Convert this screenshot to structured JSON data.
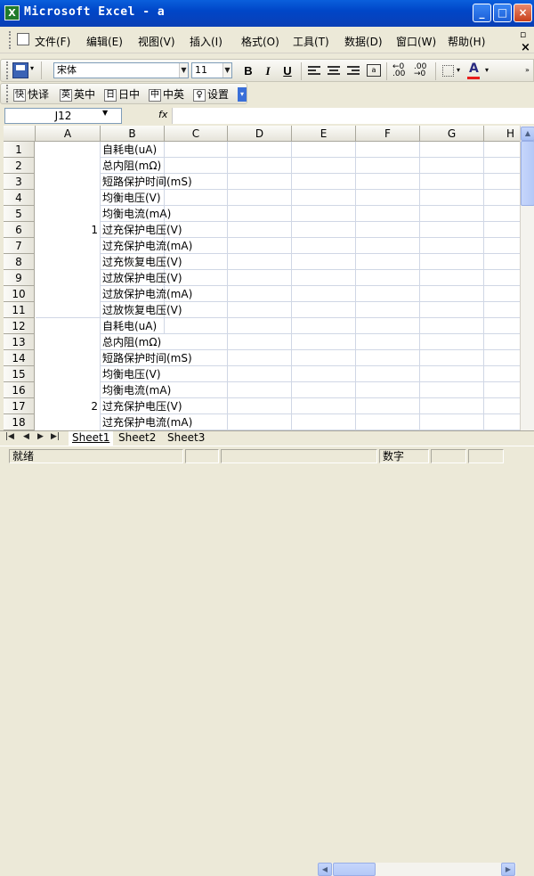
{
  "window": {
    "title": "Microsoft Excel - a",
    "app_icon": "X",
    "minimize": "_",
    "maximize": "□",
    "close": "×"
  },
  "menu": {
    "items": [
      "文件(F)",
      "编辑(E)",
      "视图(V)",
      "插入(I)",
      "格式(O)",
      "工具(T)",
      "数据(D)",
      "窗口(W)",
      "帮助(H)"
    ],
    "doc_restore": "▫",
    "doc_close": "×"
  },
  "toolbar": {
    "font_name": "宋体",
    "font_size": "11",
    "bold": "B",
    "italic": "I",
    "underline": "U"
  },
  "toolbar2": {
    "items": [
      {
        "icon": "快",
        "label": "快译"
      },
      {
        "icon": "英",
        "label": "英中"
      },
      {
        "icon": "日",
        "label": "日中"
      },
      {
        "icon": "中",
        "label": "中英"
      },
      {
        "icon": "♀",
        "label": "设置"
      }
    ]
  },
  "formula_bar": {
    "name_box": "J12",
    "fx": "fx",
    "value": ""
  },
  "grid": {
    "columns": [
      "A",
      "B",
      "C",
      "D",
      "E",
      "F",
      "G",
      "H"
    ],
    "rows": [
      "1",
      "2",
      "3",
      "4",
      "5",
      "6",
      "7",
      "8",
      "9",
      "10",
      "11",
      "12",
      "13",
      "14",
      "15",
      "16",
      "17",
      "18"
    ],
    "colB": [
      "自耗电(uA)",
      "总内阻(mΩ)",
      "短路保护时间(mS)",
      "均衡电压(V)",
      "均衡电流(mA)",
      "过充保护电压(V)",
      "过充保护电流(mA)",
      "过充恢复电压(V)",
      "过放保护电压(V)",
      "过放保护电流(mA)",
      "过放恢复电压(V)",
      "自耗电(uA)",
      "总内阻(mΩ)",
      "短路保护时间(mS)",
      "均衡电压(V)",
      "均衡电流(mA)",
      "过充保护电压(V)",
      "过充保护电流(mA)"
    ],
    "merged_a": [
      {
        "value": "1"
      },
      {
        "value": "2"
      }
    ]
  },
  "sheets": {
    "tabs": [
      "Sheet1",
      "Sheet2",
      "Sheet3"
    ],
    "active": "Sheet1"
  },
  "status": {
    "ready": "就绪",
    "mode": "数字"
  },
  "colors": {
    "title_bar": "#0a5fdc",
    "cell_grid": "#d0d7e5",
    "font_color_bar": "#e81c1c"
  }
}
